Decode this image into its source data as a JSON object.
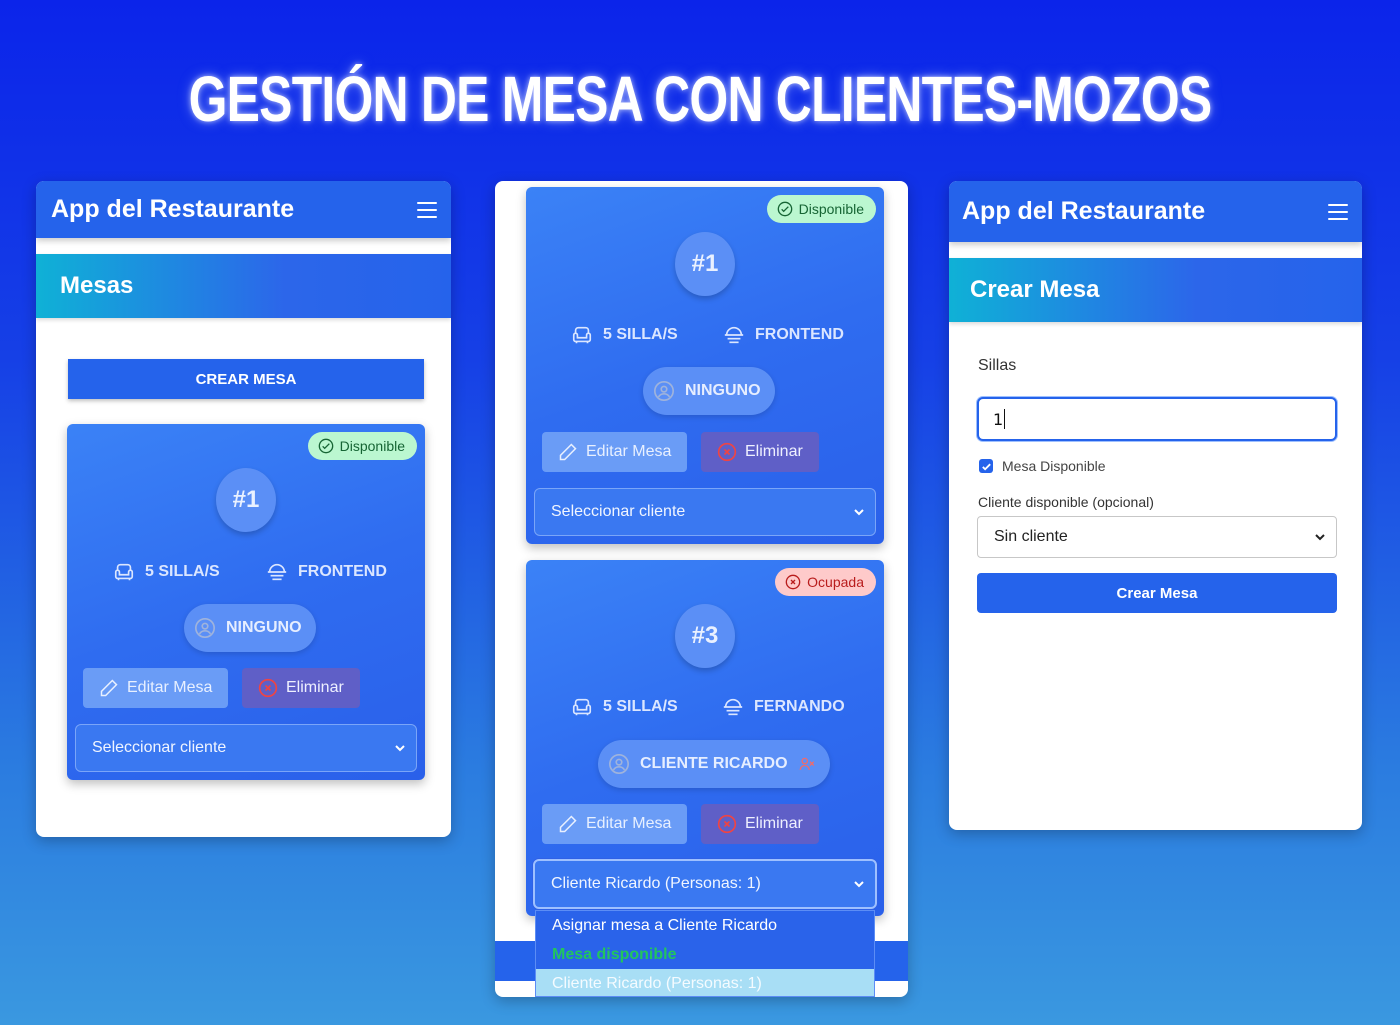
{
  "headline": "GESTIÓN DE MESA CON CLIENTES-MOZOS",
  "colors": {
    "primary": "#2563eb",
    "available_bg": "#bbf7d0",
    "available_text": "#166534",
    "occupied_bg": "#fecaca",
    "occupied_text": "#b91c1c",
    "option_available": "#22c55e"
  },
  "left_panel": {
    "app_title": "App del Restaurante",
    "section_title": "Mesas",
    "create_button": "CREAR MESA",
    "card": {
      "status": "Disponible",
      "number": "#1",
      "seats": "5 SILLA/S",
      "waiter": "FRONTEND",
      "client": "NINGUNO",
      "edit_label": "Editar Mesa",
      "delete_label": "Eliminar",
      "select_value": "Seleccionar cliente"
    }
  },
  "middle_panel": {
    "cards": [
      {
        "status": "Disponible",
        "number": "#1",
        "seats": "5 SILLA/S",
        "waiter": "FRONTEND",
        "client": "NINGUNO",
        "edit_label": "Editar Mesa",
        "delete_label": "Eliminar",
        "select_value": "Seleccionar cliente"
      },
      {
        "status": "Ocupada",
        "number": "#3",
        "seats": "5 SILLA/S",
        "waiter": "FERNANDO",
        "client": "CLIENTE RICARDO",
        "edit_label": "Editar Mesa",
        "delete_label": "Eliminar",
        "select_value": "Cliente Ricardo (Personas: 1)"
      }
    ],
    "dropdown_options": [
      "Asignar mesa a Cliente Ricardo",
      "Mesa disponible",
      "Cliente Ricardo (Personas: 1)"
    ]
  },
  "right_panel": {
    "app_title": "App del Restaurante",
    "section_title": "Crear Mesa",
    "seats_label": "Sillas",
    "seats_value": "1",
    "available_checkbox_label": "Mesa Disponible",
    "available_checked": true,
    "client_label": "Cliente disponible (opcional)",
    "client_select_value": "Sin cliente",
    "submit_label": "Crear Mesa"
  },
  "icons": {
    "menu": "hamburger-icon",
    "status_ok": "check-circle-icon",
    "status_busy": "x-circle-icon",
    "seats": "armchair-icon",
    "waiter": "waiter-hat-icon",
    "client": "user-circle-icon",
    "remove_client": "user-x-icon",
    "edit": "pencil-icon",
    "delete": "x-circle-icon",
    "select": "chevron-down-icon",
    "checkbox": "check-icon"
  }
}
